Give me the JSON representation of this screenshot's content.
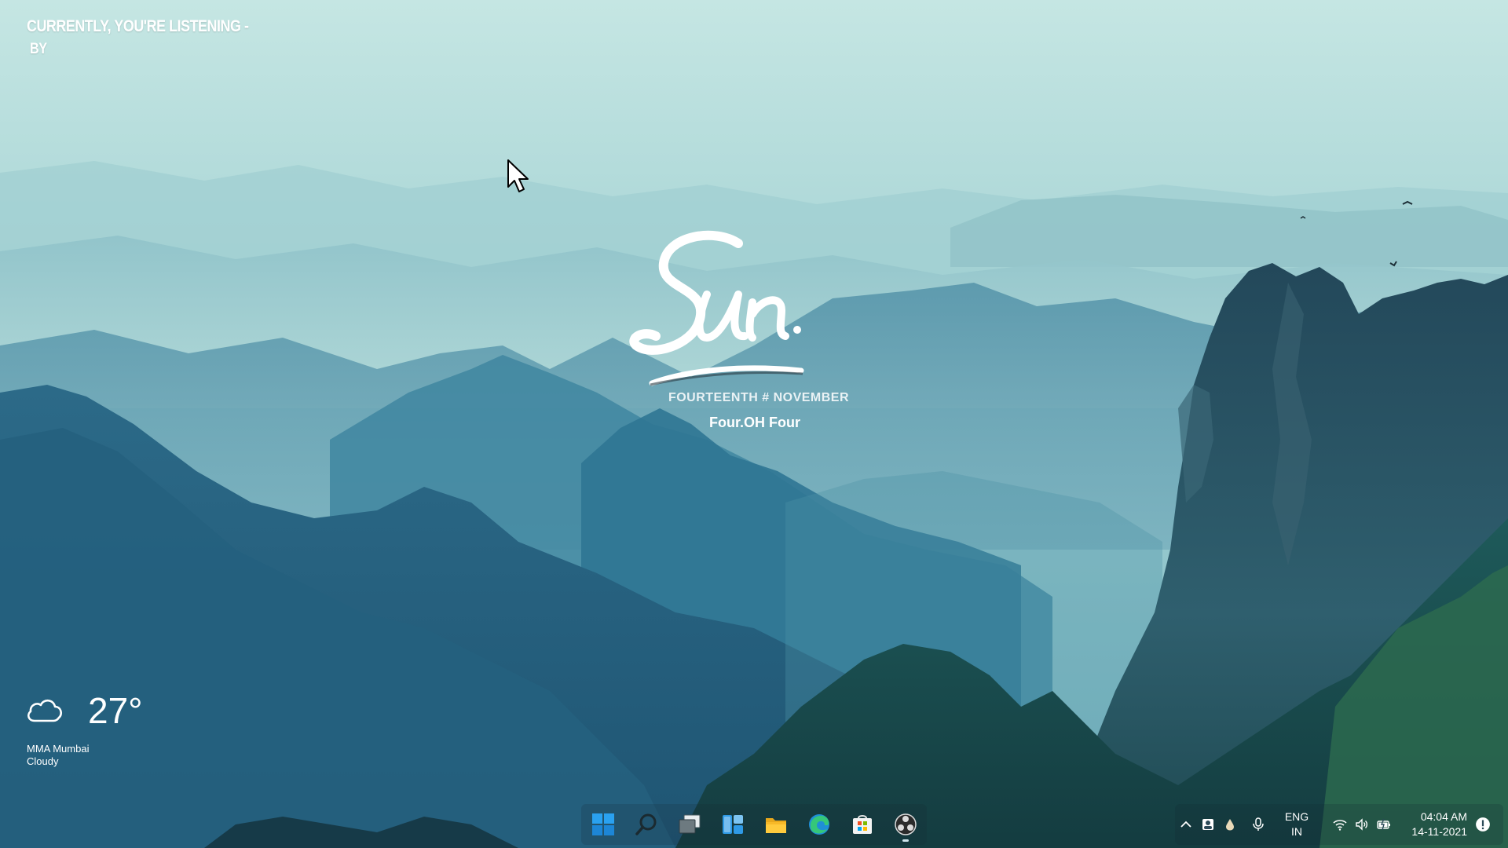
{
  "now_playing": {
    "line1": "Currently, You're Listening -",
    "line2": "By"
  },
  "date_widget": {
    "day_script": "Sun.",
    "date": "FOURTEENTH # NOVEMBER",
    "time": "Four.OH Four"
  },
  "weather": {
    "icon": "cloud-icon",
    "temperature": "27°",
    "location": "MMA Mumbai",
    "condition": "Cloudy"
  },
  "taskbar": {
    "apps": [
      {
        "name": "start",
        "icon": "windows-logo-icon"
      },
      {
        "name": "search",
        "icon": "search-icon"
      },
      {
        "name": "task-view",
        "icon": "task-view-icon"
      },
      {
        "name": "widgets",
        "icon": "widgets-icon"
      },
      {
        "name": "file-explorer",
        "icon": "folder-icon"
      },
      {
        "name": "edge",
        "icon": "edge-icon"
      },
      {
        "name": "store",
        "icon": "store-icon"
      },
      {
        "name": "obs",
        "icon": "obs-icon",
        "active": true
      }
    ]
  },
  "tray": {
    "lang_line1": "ENG",
    "lang_line2": "IN",
    "time": "04:04 AM",
    "date": "14-11-2021"
  },
  "colors": {
    "sky_top": "#bfe3e1",
    "mountains_dark": "#1b4a63",
    "accent_blue": "#2aa1f0"
  }
}
